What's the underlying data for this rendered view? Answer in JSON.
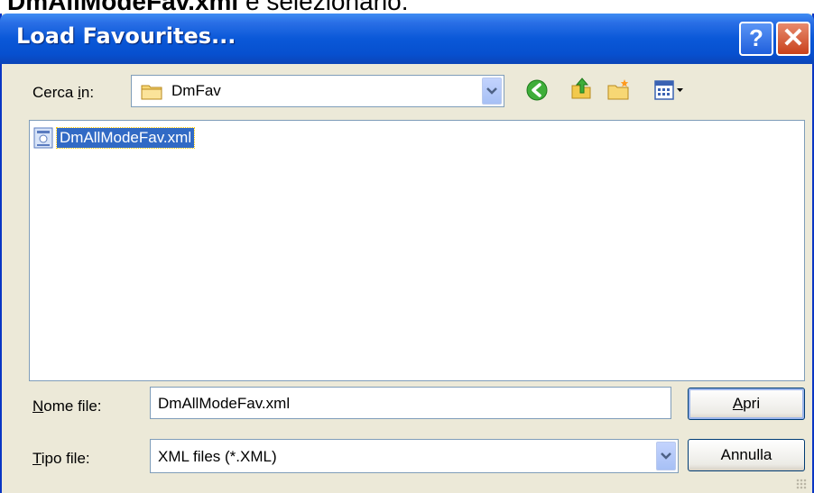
{
  "doc_heading": {
    "bold": "DmAllModeFav.xml",
    "normal": " e selezionarlo."
  },
  "window": {
    "title": "Load Favourites..."
  },
  "titlebar_buttons": {
    "help": "?",
    "close": "✕"
  },
  "look_in": {
    "label_pre": "Cerca ",
    "label_key": "i",
    "label_post": "n:",
    "value": "DmFav",
    "icon": "folder-icon"
  },
  "toolbar": [
    "back-icon",
    "up-folder-icon",
    "new-folder-icon",
    "view-menu-icon"
  ],
  "files": [
    {
      "name": "DmAllModeFav.xml",
      "icon": "xml-file-icon",
      "selected": true
    }
  ],
  "filename": {
    "label_key": "N",
    "label_rest": "ome file:",
    "value": "DmAllModeFav.xml"
  },
  "filetype": {
    "label_key": "T",
    "label_rest": "ipo file:",
    "value": "XML files (*.XML)"
  },
  "buttons": {
    "open_key": "A",
    "open_rest": "pri",
    "cancel": "Annulla"
  },
  "colors": {
    "title_bar": "#0a58d8",
    "selection": "#316ac5",
    "dialog_bg": "#ece9d8"
  }
}
